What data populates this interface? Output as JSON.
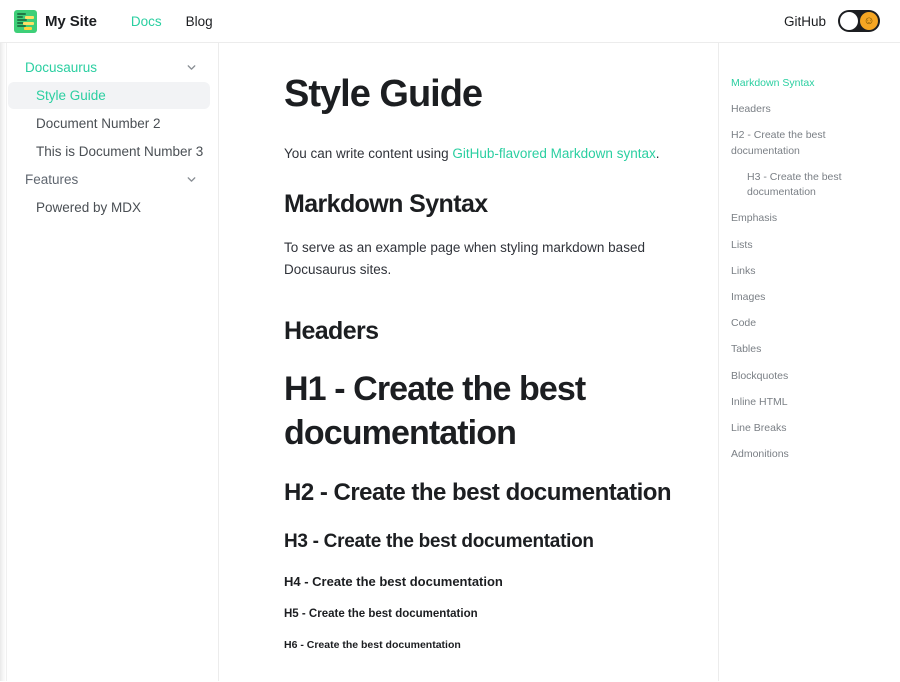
{
  "navbar": {
    "brand_title": "My Site",
    "logo_icon": "docs-logo-icon",
    "links": [
      {
        "label": "Docs",
        "active": true
      },
      {
        "label": "Blog",
        "active": false
      }
    ],
    "github_label": "GitHub",
    "theme_toggle": {
      "name": "dark-mode-toggle",
      "sun_glyph": "☺",
      "state": "light"
    }
  },
  "sidebar": {
    "categories": [
      {
        "label": "Docusaurus",
        "active": true,
        "chevron": "chevron-down-icon",
        "items": [
          {
            "label": "Style Guide",
            "active": true
          },
          {
            "label": "Document Number 2",
            "active": false
          },
          {
            "label": "This is Document Number 3",
            "active": false
          }
        ]
      },
      {
        "label": "Features",
        "active": false,
        "chevron": "chevron-down-icon",
        "items": [
          {
            "label": "Powered by MDX",
            "active": false
          }
        ]
      }
    ]
  },
  "main": {
    "title": "Style Guide",
    "intro_before": "You can write content using ",
    "intro_link": "GitHub-flavored Markdown syntax",
    "intro_after": ".",
    "markdown_syntax_heading": "Markdown Syntax",
    "markdown_syntax_body": "To serve as an example page when styling markdown based Docusaurus sites.",
    "headers_heading": "Headers",
    "h1_demo": "H1 - Create the best documentation",
    "h2_demo": "H2 - Create the best documentation",
    "h3_demo": "H3 - Create the best documentation",
    "h4_demo": "H4 - Create the best documentation",
    "h5_demo": "H5 - Create the best documentation",
    "h6_demo": "H6 - Create the best documentation"
  },
  "toc": {
    "items": [
      {
        "label": "Markdown Syntax",
        "active": true,
        "indent": false
      },
      {
        "label": "Headers",
        "active": false,
        "indent": false
      },
      {
        "label": "H2 - Create the best documentation",
        "active": false,
        "indent": false
      },
      {
        "label": "H3 - Create the best documentation",
        "active": false,
        "indent": true
      },
      {
        "label": "Emphasis",
        "active": false,
        "indent": false
      },
      {
        "label": "Lists",
        "active": false,
        "indent": false
      },
      {
        "label": "Links",
        "active": false,
        "indent": false
      },
      {
        "label": "Images",
        "active": false,
        "indent": false
      },
      {
        "label": "Code",
        "active": false,
        "indent": false
      },
      {
        "label": "Tables",
        "active": false,
        "indent": false
      },
      {
        "label": "Blockquotes",
        "active": false,
        "indent": false
      },
      {
        "label": "Inline HTML",
        "active": false,
        "indent": false
      },
      {
        "label": "Line Breaks",
        "active": false,
        "indent": false
      },
      {
        "label": "Admonitions",
        "active": false,
        "indent": false
      }
    ]
  },
  "colors": {
    "brand_green": "#2bcfa1",
    "text_dark": "#1c1e21",
    "text_muted": "#7a7f85",
    "border": "#ececec",
    "active_bg": "#f2f3f5"
  }
}
